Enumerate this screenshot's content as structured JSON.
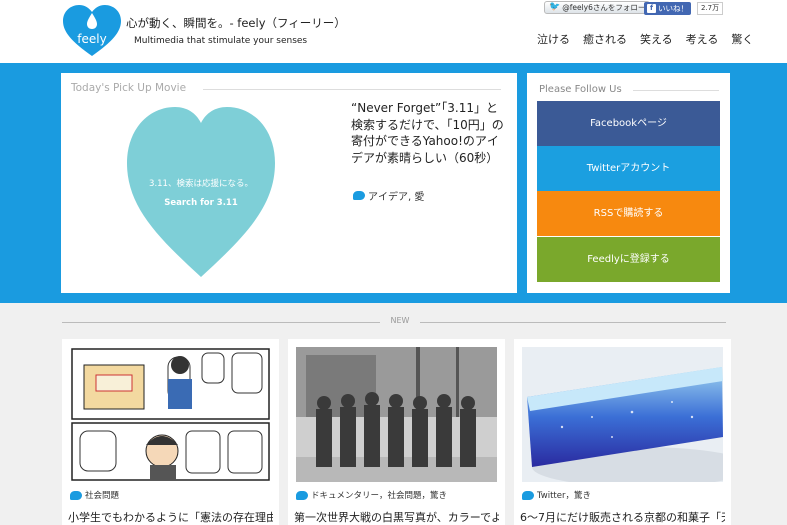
{
  "header": {
    "logo_text": "feely",
    "tagline": "心が動く、瞬間を。- feely（フィーリー）",
    "subline": "Multimedia that stimulate your senses",
    "twitter_follow": "@feely6さんをフォロー",
    "fb_like": "いいね！",
    "fb_count": "2.7万",
    "nav": [
      "泣ける",
      "癒される",
      "笑える",
      "考える",
      "驚く"
    ]
  },
  "pickup": {
    "title": "Today's Pick Up Movie",
    "heart_line1": "3.11、検索は応援になる。",
    "heart_line2": "Search for 3.11",
    "headline": "“Never Forget”「3.11」と検索するだけで、「10円」の寄付ができるYahoo!のアイデアが素晴らしい（60秒）",
    "tags": "アイデア, 愛"
  },
  "follow": {
    "title": "Please Follow Us",
    "buttons": [
      {
        "label": "Facebookページ",
        "color": "#3b5a96"
      },
      {
        "label": "Twitterアカウント",
        "color": "#1b9fe0"
      },
      {
        "label": "RSSで購読する",
        "color": "#f7890f"
      },
      {
        "label": "Feedlyに登録する",
        "color": "#7aa82c"
      }
    ]
  },
  "new_label": "NEW",
  "cards": [
    {
      "tags": "社会問題",
      "title": "小学生でもわかるように「憲法の存在理由」"
    },
    {
      "tags": "ドキュメンタリー，社会問題，驚き",
      "title": "第一次世界大戦の白黒写真が、カラーでよ"
    },
    {
      "tags": "Twitter，驚き",
      "title": "6～7月にだけ販売される京都の和菓子「天"
    }
  ],
  "colors": {
    "accent": "#1a9be0",
    "heart": "#7ecfd7"
  }
}
